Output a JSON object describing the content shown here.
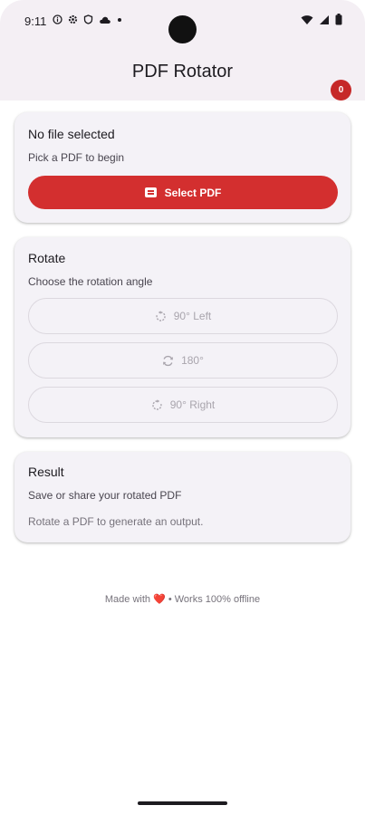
{
  "status_bar": {
    "time": "9:11",
    "icons_left": [
      "info-circle-icon",
      "gear-icon",
      "shield-icon",
      "cloud-icon",
      "dot-icon"
    ],
    "icons_right": [
      "wifi-icon",
      "signal-icon",
      "battery-icon"
    ]
  },
  "app_bar": {
    "title": "PDF Rotator",
    "badge_count": "0"
  },
  "file_card": {
    "title": "No file selected",
    "subtitle": "Pick a PDF to begin",
    "select_button_label": "Select PDF",
    "select_button_icon": "pdf-file-icon"
  },
  "rotate_card": {
    "title": "Rotate",
    "subtitle": "Choose the rotation angle",
    "options": [
      {
        "label": "90° Left",
        "icon": "rotate-left-icon"
      },
      {
        "label": "180°",
        "icon": "rotate-icon"
      },
      {
        "label": "90° Right",
        "icon": "rotate-right-icon"
      }
    ]
  },
  "result_card": {
    "title": "Result",
    "subtitle": "Save or share your rotated PDF",
    "note": "Rotate a PDF to generate an output."
  },
  "footer": {
    "prefix": "Made with ",
    "heart": "❤️",
    "suffix": " • Works 100% offline"
  },
  "colors": {
    "accent": "#d32f2f",
    "badge": "#c62828",
    "card_background": "#f4f2f7",
    "top_background": "#f4eff4"
  }
}
